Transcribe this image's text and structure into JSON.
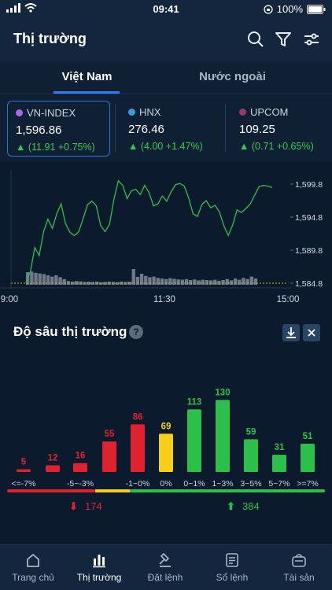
{
  "status": {
    "time": "09:41",
    "battery": "100%"
  },
  "header": {
    "title": "Thị trường"
  },
  "tabs": [
    {
      "label": "Việt Nam",
      "active": true
    },
    {
      "label": "Nước ngoài",
      "active": false
    }
  ],
  "indices": [
    {
      "name": "VN-INDEX",
      "value": "1,596.86",
      "change": "(11.91 +0.75%)",
      "dot": "#a86ae8",
      "selected": true
    },
    {
      "name": "HNX",
      "value": "276.46",
      "change": "(4.00 +1.47%)",
      "dot": "#3a9bd8",
      "selected": false
    },
    {
      "name": "UPCOM",
      "value": "109.25",
      "change": "(0.71 +0.65%)",
      "dot": "#9a3a6a",
      "selected": false
    }
  ],
  "intraday": {
    "y_ticks": [
      "1,599.8",
      "1,594.8",
      "1,589.8",
      "1,584.8"
    ],
    "x_ticks": [
      "9:00",
      "11:30",
      "15:00"
    ],
    "y_values": [
      1599.8,
      1594.8,
      1589.8,
      1584.8
    ],
    "reference": 1584.8,
    "prices": [
      1584.9,
      1586.5,
      1590.2,
      1589.0,
      1592.6,
      1594.5,
      1593.1,
      1595.3,
      1596.8,
      1593.8,
      1592.5,
      1592.0,
      1592.6,
      1594.6,
      1596.7,
      1597.2,
      1596.5,
      1593.5,
      1592.6,
      1593.7,
      1597.5,
      1600.3,
      1599.6,
      1597.6,
      1598.8,
      1599.0,
      1598.2,
      1599.6,
      1598.5,
      1596.5,
      1596.8,
      1598.0,
      1597.2,
      1598.6,
      1599.7,
      1599.9,
      1599.5,
      1597.7,
      1595.3,
      1594.9,
      1596.7,
      1597.3,
      1596.2,
      1596.6,
      1595.6,
      1593.5,
      1592.0,
      1593.6,
      1595.9,
      1595.5,
      1596.1,
      1596.8,
      1598.1,
      1599.4,
      1599.6,
      1599.5,
      1599.3
    ],
    "volume": [
      0.4,
      0.42,
      0.38,
      0.36,
      0.34,
      0.3,
      0.26,
      0.3,
      0.24,
      0.18,
      0.12,
      0.1,
      0.12,
      0.11,
      0.09,
      0.1,
      0.09,
      0.1,
      0.08,
      0.09,
      0.1,
      0.09,
      0.08,
      0.1,
      0.09,
      0.1,
      0.5,
      0.25,
      0.35,
      0.28,
      0.24,
      0.26,
      0.22,
      0.2,
      0.18,
      0.21,
      0.19,
      0.17,
      0.16,
      0.18,
      0.15,
      0.17,
      0.14,
      0.16,
      0.15,
      0.14,
      0.16,
      0.13,
      0.15,
      0.18,
      0.14,
      0.2,
      0.16,
      0.22,
      0.18,
      0.26,
      0.2
    ],
    "colors": {
      "line": "#2fbf4b",
      "reference": "#d9b100"
    }
  },
  "depth": {
    "title": "Độ sâu thị trường",
    "help": "?",
    "categories": [
      "<=-7%",
      "-5~-3%",
      "-1~0%",
      "0%",
      "0~1%",
      "1~3%",
      "3~5%",
      "5~7%",
      ">=7%"
    ],
    "values": [
      5,
      12,
      16,
      55,
      86,
      69,
      113,
      130,
      59,
      31,
      51
    ],
    "bar_colors": [
      "#e0222f",
      "#e0222f",
      "#e0222f",
      "#e0222f",
      "#e0222f",
      "#f6cf1a",
      "#2cc04a",
      "#2cc04a",
      "#2cc04a",
      "#2cc04a",
      "#2cc04a"
    ],
    "declines": "174",
    "advances": "384",
    "colors": {
      "down": "#e0222f",
      "flat": "#f6cf1a",
      "up": "#2cc04a"
    }
  },
  "nav": [
    {
      "label": "Trang chủ",
      "icon": "home-icon",
      "active": false
    },
    {
      "label": "Thị trường",
      "icon": "bar-chart-icon",
      "active": true
    },
    {
      "label": "Đặt lệnh",
      "icon": "gavel-icon",
      "active": false
    },
    {
      "label": "Sổ lệnh",
      "icon": "order-book-icon",
      "active": false
    },
    {
      "label": "Tài sản",
      "icon": "wallet-icon",
      "active": false
    }
  ]
}
